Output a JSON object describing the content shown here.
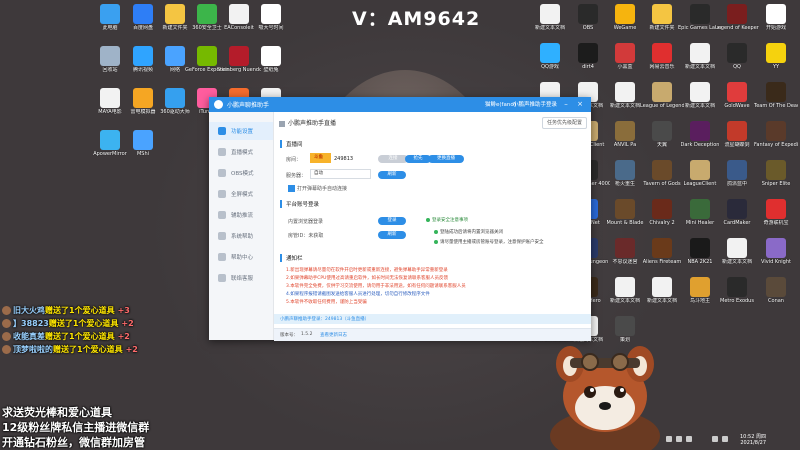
{
  "banner": {
    "text": "V：AM9642"
  },
  "desktop_left": [
    {
      "label": "此电脑",
      "color": "#3aa0f0"
    },
    {
      "label": "百度网盘",
      "color": "#2e7ef6"
    },
    {
      "label": "新建文件夹",
      "color": "#f4c542"
    },
    {
      "label": "360安全卫士",
      "color": "#3cb54a"
    },
    {
      "label": "EAConsoleit",
      "color": "#f2f2f2"
    },
    {
      "label": "吸大号时间",
      "color": "#ffffff"
    },
    {
      "label": "回收站",
      "color": "#9fb3c8"
    },
    {
      "label": "腾讯视频",
      "color": "#2fa4ff"
    },
    {
      "label": "网络",
      "color": "#4aa3ff"
    },
    {
      "label": "GeForce Experience",
      "color": "#76b900"
    },
    {
      "label": "Steinberg Nuendo 4",
      "color": "#b41c2a"
    },
    {
      "label": "壁纸兔",
      "color": "#ffffff"
    },
    {
      "label": "MAYA电影",
      "color": "#f2f2f2"
    },
    {
      "label": "雷电模拟器",
      "color": "#f5a623"
    },
    {
      "label": "360驱动大师",
      "color": "#35a0ef"
    },
    {
      "label": "iTunes",
      "color": "#ff5d9e"
    },
    {
      "label": "Origin",
      "color": "#f56c2d"
    },
    {
      "label": "新建文本文档",
      "color": "#f2f2f2"
    },
    {
      "label": "ApowerMirror",
      "color": "#3cb3f0"
    },
    {
      "label": "MShi",
      "color": "#4aa3ff"
    }
  ],
  "desktop_right": [
    {
      "label": "新建文本文档",
      "color": "#f2f2f2"
    },
    {
      "label": "OBS",
      "color": "#2a2a2a"
    },
    {
      "label": "WeGame",
      "color": "#f6b40e"
    },
    {
      "label": "新建文件夹",
      "color": "#f4c542"
    },
    {
      "label": "Epic Games Launcher",
      "color": "#2a2a2a"
    },
    {
      "label": "Legend of Keepers",
      "color": "#7a1e1e"
    },
    {
      "label": "开始游戏",
      "color": "#ffffff"
    },
    {
      "label": "QQ游戏",
      "color": "#2fb0ff"
    },
    {
      "label": "dirt4",
      "color": "#1c1c1c"
    },
    {
      "label": "小黑盒",
      "color": "#d23a3a"
    },
    {
      "label": "网易云音乐",
      "color": "#e02f2f"
    },
    {
      "label": "新建文本文档",
      "color": "#f2f2f2"
    },
    {
      "label": "QQ",
      "color": "#2a2a2a"
    },
    {
      "label": "YY",
      "color": "#f5d20e"
    },
    {
      "label": "新建文本文档",
      "color": "#f2f2f2"
    },
    {
      "label": "新建文本文档",
      "color": "#f2f2f2"
    },
    {
      "label": "新建文本文档",
      "color": "#f2f2f2"
    },
    {
      "label": "League of Legends",
      "color": "#c8aa6e"
    },
    {
      "label": "新建文本文档",
      "color": "#f2f2f2"
    },
    {
      "label": "GoldWave",
      "color": "#e03c3c"
    },
    {
      "label": "Team Of The Dead",
      "color": "#3a2a1a"
    },
    {
      "label": "新建文本文档",
      "color": "#f2f2f2"
    },
    {
      "label": "LeagueClient",
      "color": "#c8aa6e"
    },
    {
      "label": "ANVIL Pa",
      "color": "#8a6d3b"
    },
    {
      "label": "天翼",
      "color": "#4a4a4a"
    },
    {
      "label": "Dark Deception",
      "color": "#5a1e5e"
    },
    {
      "label": "流星蝴蝶剑",
      "color": "#c23a2a"
    },
    {
      "label": "Fantasy of Expedition",
      "color": "#5a3a2a"
    },
    {
      "label": "新建文本文档",
      "color": "#f2f2f2"
    },
    {
      "label": "Warhammer 40000",
      "color": "#2a2a2a"
    },
    {
      "label": "枪火重生",
      "color": "#4a6a8a"
    },
    {
      "label": "Tavern of Gods",
      "color": "#6a4a2a"
    },
    {
      "label": "LeagueClient",
      "color": "#c8aa6e"
    },
    {
      "label": "鸽派蓝中",
      "color": "#3a5a8a"
    },
    {
      "label": "Sniper Elite",
      "color": "#6a5a2a"
    },
    {
      "label": "新建文本文档",
      "color": "#f2f2f2"
    },
    {
      "label": "BattleNet",
      "color": "#2a6ad8"
    },
    {
      "label": "Mount & Blade",
      "color": "#6a4a2a"
    },
    {
      "label": "Chivalry 2",
      "color": "#6a2a1a"
    },
    {
      "label": "Mini Healer",
      "color": "#3a6a3a"
    },
    {
      "label": "CardMaker",
      "color": "#2a2a3a"
    },
    {
      "label": "奇游联机宝",
      "color": "#e02f2f"
    },
    {
      "label": "新建文本文档",
      "color": "#f2f2f2"
    },
    {
      "label": "Lost in Dungeon",
      "color": "#2a3a6a"
    },
    {
      "label": "不思议迷宫",
      "color": "#6a2a2a"
    },
    {
      "label": "Aliens Fireteam",
      "color": "#6a3a1a"
    },
    {
      "label": "NBA 2K21",
      "color": "#1a1a1a"
    },
    {
      "label": "新建文本文档",
      "color": "#f2f2f2"
    },
    {
      "label": "Vivid Knight",
      "color": "#8a6ac8"
    },
    {
      "label": "新建文本文档",
      "color": "#f2f2f2"
    },
    {
      "label": "Loop Hero",
      "color": "#3a2a1a"
    },
    {
      "label": "新建文本文档",
      "color": "#f2f2f2"
    },
    {
      "label": "新建文本文档",
      "color": "#f2f2f2"
    },
    {
      "label": "鸟斗地主",
      "color": "#e0a02f"
    },
    {
      "label": "Metro Exodus",
      "color": "#2a2a2a"
    },
    {
      "label": "Conan",
      "color": "#5a4a3a"
    },
    {
      "label": "Bum Simulator",
      "color": "#2a4a6a"
    },
    {
      "label": "新建文本文档",
      "color": "#f2f2f2"
    },
    {
      "label": "策划",
      "color": "#4a4a4a"
    }
  ],
  "app": {
    "title": "小鹏声聊推助手",
    "title_right_1": "猫鲱e(fand)",
    "title_right_2": "小鹏声推助手登录",
    "nav": [
      {
        "label": "功能设置",
        "active": true
      },
      {
        "label": "直播模式",
        "active": false
      },
      {
        "label": "OBS模式",
        "active": false
      },
      {
        "label": "全屏模式",
        "active": false
      },
      {
        "label": "辅助推流",
        "active": false
      },
      {
        "label": "系统帮助",
        "active": false
      },
      {
        "label": "帮助中心",
        "active": false
      },
      {
        "label": "联络客服",
        "active": false
      }
    ],
    "crumb": "小鹏声推助手直播",
    "top_button": "任务优先级配置",
    "section_live": "直播间",
    "room_label": "房间：",
    "room_platform": "斗鱼",
    "room_id": "249813",
    "btn_a": "连接",
    "btn_b": "抢先",
    "btn_c": "更换直播",
    "server_label": "服务器：",
    "server_value": "自动",
    "server_btn": "刷新",
    "checkbox_label": "打开弹幕助手自动连接",
    "section_platform": "平台账号登录",
    "acc1_label": "内置浏览器登录",
    "acc1_btn": "登录",
    "acc2_label": "房管ID：未获取",
    "acc2_btn": "刷新",
    "security_title": "登录安全注意事项",
    "tips": [
      "登陆成功后请将内置浏览器关闭",
      "请尽量使用主播或房管账号登录，注意保护账户安全"
    ],
    "section_notice": "通知栏",
    "notices": [
      "1.新出现弹幕请尽量勿在软件开启时更新或重新连接，避免弹幕助手异常重新登录",
      "2.如果弹幕助手CPU使用过高请重启软件，如长时间无法恢复请联系客服人员反馈",
      "3.本软件完全免费，仅供学习交流使用，请勿用于非法用途，如有任何问题请联系客服人员",
      "4.如果程序报错请截图发送给客服人员进行处理，切勿自行修改程序文件",
      "5.本软件不收取任何费用，谨防上当受骗"
    ],
    "notice_blue_index": 3,
    "status_green": "小鹏声聊推助手登录：249813（斗鱼直播）",
    "status_version_label": "版本号：",
    "status_version": "1.5.2",
    "status_link": "查看更新日志"
  },
  "chat": [
    {
      "name": "旧大火鸡",
      "text": "赠送了1个爱心道具",
      "plus": "+3"
    },
    {
      "name": "】38823",
      "text": "赠送了1个爱心道具",
      "plus": "+2"
    },
    {
      "name": "收能真差",
      "text": "赠送了1个爱心道具",
      "plus": "+2"
    },
    {
      "name": "顶梦啦啦的",
      "text": "赠送了1个爱心道具",
      "plus": "+2"
    }
  ],
  "promo": [
    "求送荧光棒和爱心道具",
    "12级粉丝牌私信主播进微信群",
    "开通钻石粉丝，微信群加房管"
  ],
  "clock": {
    "time": "10:52 周四",
    "date": "2021/8/27"
  }
}
